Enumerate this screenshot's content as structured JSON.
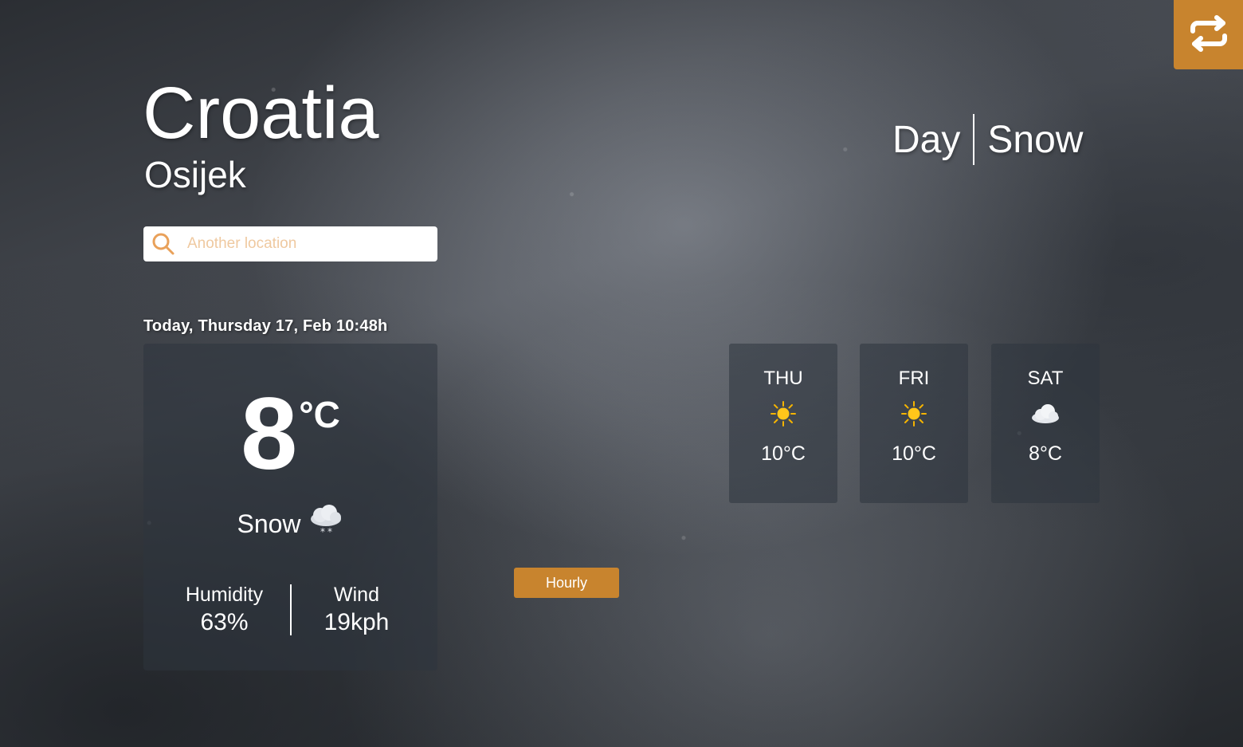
{
  "header": {
    "swap_icon": "swap-arrows-icon",
    "accent_color": "#c8842e"
  },
  "location": {
    "city": "Croatia",
    "country": "Osijek"
  },
  "search": {
    "icon": "search-icon",
    "placeholder": "Another location",
    "value": ""
  },
  "date_line": "Today, Thursday 17, Feb 10:48h",
  "current": {
    "temperature": "8",
    "unit": "°C",
    "condition": "Snow",
    "condition_icon": "snow-cloud-icon",
    "humidity_label": "Humidity",
    "humidity_value": "63%",
    "wind_label": "Wind",
    "wind_value": "19kph"
  },
  "mode": {
    "time_of_day": "Day",
    "weather": "Snow"
  },
  "forecast": [
    {
      "day": "THU",
      "icon": "sun-icon",
      "temp": "10°C"
    },
    {
      "day": "FRI",
      "icon": "sun-icon",
      "temp": "10°C"
    },
    {
      "day": "SAT",
      "icon": "cloud-icon",
      "temp": "8°C"
    }
  ],
  "hourly_button": "Hourly"
}
